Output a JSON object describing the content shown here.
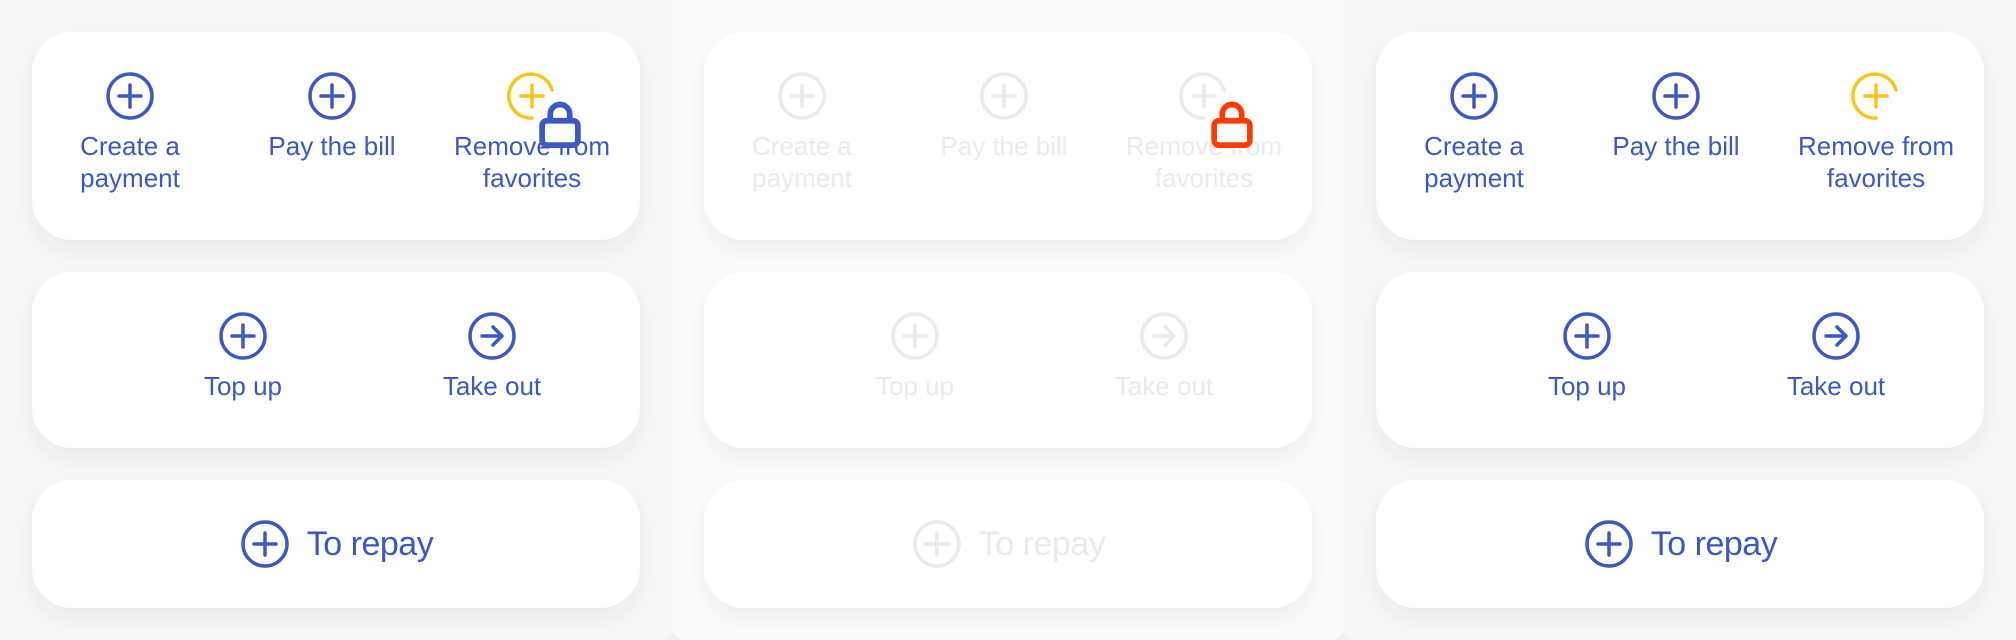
{
  "colors": {
    "accent": "#3d57c4",
    "favorite_yellow": "#f6c619",
    "lock_red": "#ff3b00",
    "disabled": "#eaeaee"
  },
  "panels": [
    {
      "state": "default",
      "actions": [
        {
          "label": "Create a payment",
          "icon": "plus-circle-icon"
        },
        {
          "label": "Pay the bill",
          "icon": "plus-circle-icon"
        },
        {
          "label": "Remove from favorites",
          "icon": "favorite-plus-icon",
          "badge": "lock-icon"
        }
      ],
      "transfers": [
        {
          "label": "Top up",
          "icon": "plus-circle-icon"
        },
        {
          "label": "Take out",
          "icon": "arrow-right-circle-icon"
        }
      ],
      "repay": {
        "label": "To repay",
        "icon": "plus-circle-icon"
      }
    },
    {
      "state": "disabled",
      "actions": [
        {
          "label": "Create a payment",
          "icon": "plus-circle-icon"
        },
        {
          "label": "Pay the bill",
          "icon": "plus-circle-icon"
        },
        {
          "label": "Remove from favorites",
          "icon": "favorite-plus-icon",
          "badge": "lock-icon"
        }
      ],
      "transfers": [
        {
          "label": "Top up",
          "icon": "plus-circle-icon"
        },
        {
          "label": "Take out",
          "icon": "arrow-right-circle-icon"
        }
      ],
      "repay": {
        "label": "To repay",
        "icon": "plus-circle-icon"
      }
    },
    {
      "state": "default",
      "actions": [
        {
          "label": "Create a payment",
          "icon": "plus-circle-icon"
        },
        {
          "label": "Pay the bill",
          "icon": "plus-circle-icon"
        },
        {
          "label": "Remove from favorites",
          "icon": "favorite-plus-icon"
        }
      ],
      "transfers": [
        {
          "label": "Top up",
          "icon": "plus-circle-icon"
        },
        {
          "label": "Take out",
          "icon": "arrow-right-circle-icon"
        }
      ],
      "repay": {
        "label": "To repay",
        "icon": "plus-circle-icon"
      }
    }
  ]
}
